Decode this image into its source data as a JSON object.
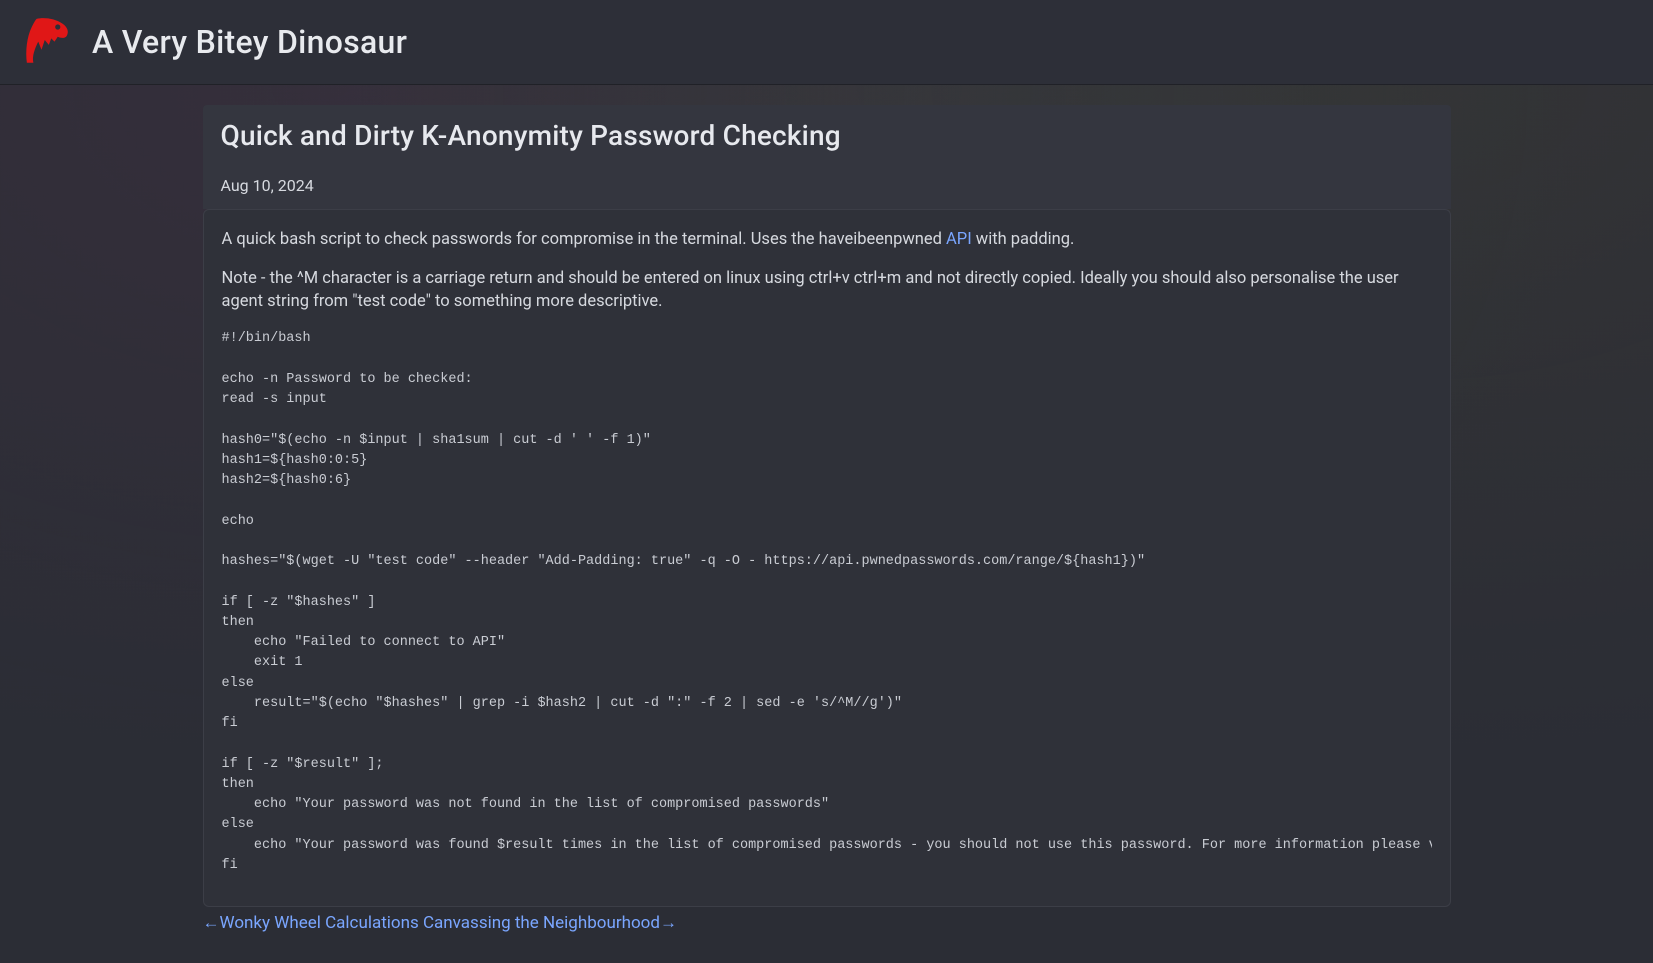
{
  "header": {
    "site_title": "A Very Bitey Dinosaur"
  },
  "post": {
    "title": "Quick and Dirty K-Anonymity Password Checking",
    "date": "Aug 10, 2024",
    "intro_part1": "A quick bash script to check passwords for compromise in the terminal. Uses the haveibeenpwned ",
    "intro_link_text": "API",
    "intro_part2": " with padding.",
    "note": "Note - the ^M character is a carriage return and should be entered on linux using ctrl+v ctrl+m and not directly copied. Ideally you should also personalise the user agent string from \"test code\" to something more descriptive.",
    "code": "#!/bin/bash\n\necho -n Password to be checked:\nread -s input\n\nhash0=\"$(echo -n $input | sha1sum | cut -d ' ' -f 1)\"\nhash1=${hash0:0:5}\nhash2=${hash0:6}\n\necho\n\nhashes=\"$(wget -U \"test code\" --header \"Add-Padding: true\" -q -O - https://api.pwnedpasswords.com/range/${hash1})\"\n\nif [ -z \"$hashes\" ]\nthen\n    echo \"Failed to connect to API\"\n    exit 1\nelse\n    result=\"$(echo \"$hashes\" | grep -i $hash2 | cut -d \":\" -f 2 | sed -e 's/^M//g')\"\nfi\n\nif [ -z \"$result\" ];\nthen\n    echo \"Your password was not found in the list of compromised passwords\"\nelse\n    echo \"Your password was found $result times in the list of compromised passwords - you should not use this password. For more information please visit https://haveibeenpwned.com/\nfi"
  },
  "nav": {
    "prev_arrow": "←",
    "prev_label": "Wonky Wheel Calculations",
    "next_label": "Canvassing the Neighbourhood",
    "next_arrow": "→"
  }
}
